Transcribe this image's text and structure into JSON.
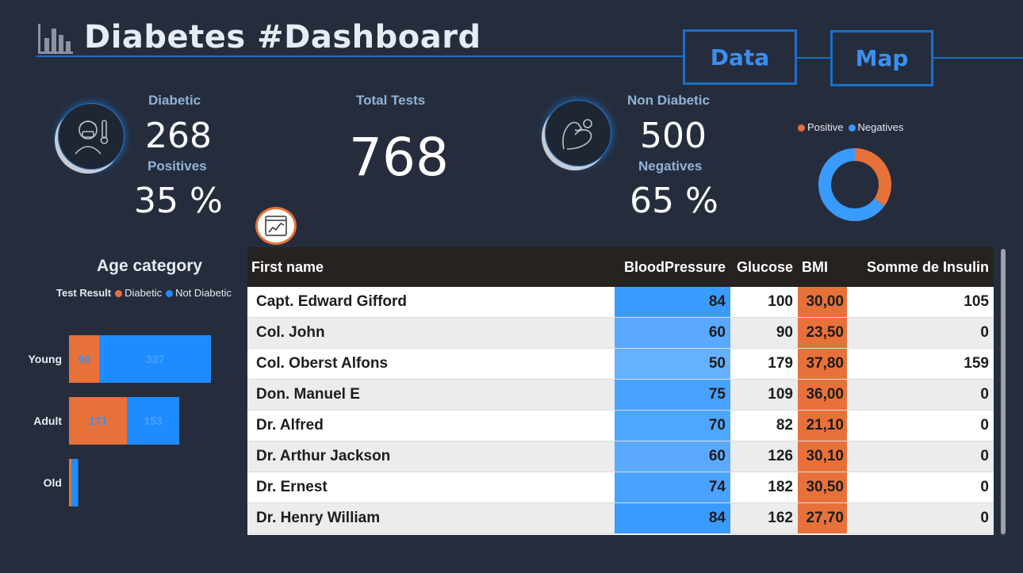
{
  "header": {
    "title": "Diabetes #Dashboard",
    "logo_icon": "bar-chart-icon"
  },
  "nav": {
    "data_label": "Data",
    "map_label": "Map"
  },
  "kpis": {
    "diabetic_label": "Diabetic",
    "diabetic_value": "268",
    "positives_label": "Positives",
    "positives_pct": "35 %",
    "total_label": "Total Tests",
    "total_value": "768",
    "non_diabetic_label": "Non Diabetic",
    "non_diabetic_value": "500",
    "negatives_label": "Negatives",
    "negatives_pct": "65 %"
  },
  "donut": {
    "legend": [
      {
        "label": "Positive",
        "color": "#e8713a"
      },
      {
        "label": "Negatives",
        "color": "#3a9bff"
      }
    ],
    "chart_data": {
      "type": "pie",
      "categories": [
        "Positive",
        "Negatives"
      ],
      "values": [
        268,
        500
      ]
    }
  },
  "age_chart": {
    "title": "Age category",
    "legend_title": "Test Result",
    "legend": [
      {
        "label": "Diabetic",
        "color": "#e8713a"
      },
      {
        "label": "Not Diabetic",
        "color": "#1e8cff"
      }
    ],
    "chart_data": {
      "type": "bar",
      "orientation": "horizontal",
      "stacked": true,
      "categories": [
        "Young",
        "Adult",
        "Old"
      ],
      "series": [
        {
          "name": "Diabetic",
          "values": [
            90,
            171,
            7
          ]
        },
        {
          "name": "Not Diabetic",
          "values": [
            327,
            153,
            20
          ]
        }
      ],
      "value_labels": [
        [
          "90",
          "171",
          ""
        ],
        [
          "327",
          "153",
          ""
        ]
      ]
    }
  },
  "table": {
    "columns": [
      "First name",
      "BloodPressure",
      "Glucose",
      "BMI",
      "Somme de Insulin"
    ],
    "rows": [
      [
        "Capt. Edward Gifford",
        "84",
        "100",
        "30,00",
        "105"
      ],
      [
        "Col. John",
        "60",
        "90",
        "23,50",
        "0"
      ],
      [
        "Col. Oberst Alfons",
        "50",
        "179",
        "37,80",
        "159"
      ],
      [
        "Don. Manuel E",
        "75",
        "109",
        "36,00",
        "0"
      ],
      [
        "Dr. Alfred",
        "70",
        "82",
        "21,10",
        "0"
      ],
      [
        "Dr. Arthur Jackson",
        "60",
        "126",
        "30,10",
        "0"
      ],
      [
        "Dr. Ernest",
        "74",
        "182",
        "30,50",
        "0"
      ],
      [
        "Dr. Henry William",
        "84",
        "162",
        "27,70",
        "0"
      ]
    ]
  }
}
